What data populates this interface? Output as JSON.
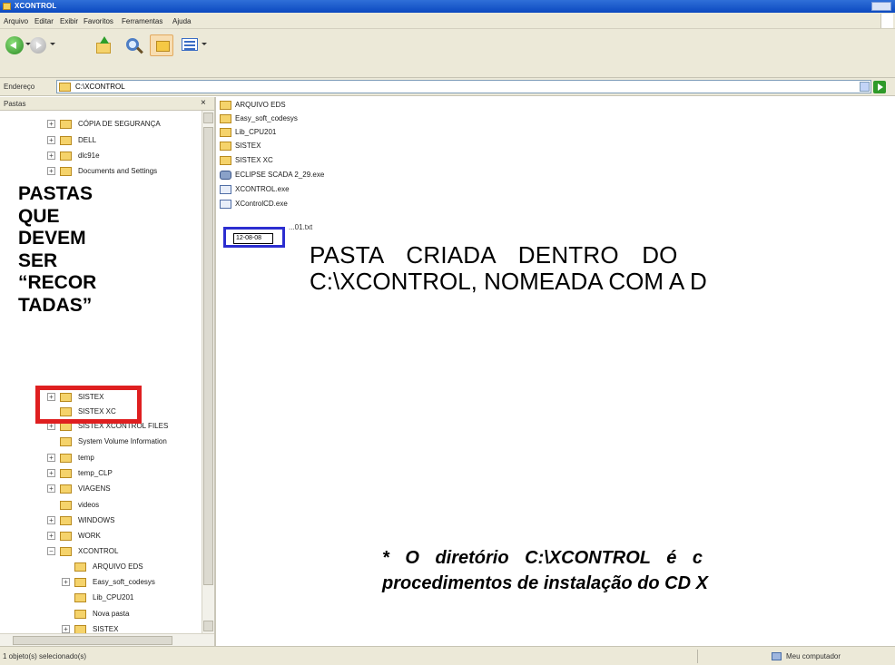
{
  "window": {
    "title": "XCONTROL"
  },
  "menu": [
    "Arquivo",
    "Editar",
    "Exibir",
    "Favoritos",
    "Ferramentas",
    "Ajuda"
  ],
  "address": {
    "label": "Endereço",
    "path": "C:\\XCONTROL"
  },
  "folders_pane": {
    "title": "Pastas",
    "close": "×",
    "tree": [
      {
        "label": "CÓPIA DE SEGURANÇA",
        "expander": "+"
      },
      {
        "label": "DELL",
        "expander": "+"
      },
      {
        "label": "dlc91e",
        "expander": "+"
      },
      {
        "label": "Documents and Settings",
        "expander": "+"
      },
      {
        "label": "SISTEX",
        "expander": "+"
      },
      {
        "label": "SISTEX XC",
        "expander": ""
      },
      {
        "label": "SISTEX XCONTROL FILES",
        "expander": "+"
      },
      {
        "label": "System Volume Information",
        "expander": ""
      },
      {
        "label": "temp",
        "expander": "+"
      },
      {
        "label": "temp_CLP",
        "expander": "+"
      },
      {
        "label": "VIAGENS",
        "expander": "+"
      },
      {
        "label": "videos",
        "expander": ""
      },
      {
        "label": "WINDOWS",
        "expander": "+"
      },
      {
        "label": "WORK",
        "expander": "+"
      },
      {
        "label": "XCONTROL",
        "expander": "−"
      },
      {
        "label": "ARQUIVO EDS",
        "expander": ""
      },
      {
        "label": "Easy_soft_codesys",
        "expander": "+"
      },
      {
        "label": "Lib_CPU201",
        "expander": ""
      },
      {
        "label": "Nova pasta",
        "expander": ""
      },
      {
        "label": "SISTEX",
        "expander": "+"
      }
    ]
  },
  "files": [
    {
      "name": "ARQUIVO EDS",
      "icon": "folder-icon"
    },
    {
      "name": "Easy_soft_codesys",
      "icon": "folder-icon"
    },
    {
      "name": "Lib_CPU201",
      "icon": "folder-icon"
    },
    {
      "name": "SISTEX",
      "icon": "folder-icon"
    },
    {
      "name": "SISTEX XC",
      "icon": "folder-icon"
    },
    {
      "name": "ECLIPSE SCADA 2_29.exe",
      "icon": "gear-icon"
    },
    {
      "name": "XCONTROL.exe",
      "icon": "exe-icon"
    },
    {
      "name": "XControlCD.exe",
      "icon": "exe-icon"
    },
    {
      "name": "...01.txt",
      "icon": "text-file-icon"
    }
  ],
  "rename": {
    "value": "12-08-08"
  },
  "annotations": {
    "left_lines": [
      "PASTAS",
      "QUE",
      "DEVEM",
      "SER",
      "“RECOR",
      "TADAS”"
    ],
    "main_line1": "PASTA CRIADA DENTRO DO",
    "main_line2": "C:\\XCONTROL, NOMEADA COM A D",
    "note_line1": "* O diretório C:\\XCONTROL é c",
    "note_line2": "procedimentos de instalação do CD X"
  },
  "status": {
    "left": "1 objeto(s) selecionado(s)",
    "right": "Meu computador"
  },
  "colors": {
    "highlight_red": "#df1f20",
    "highlight_blue": "#2c2ed0",
    "titlebar": "#0b49c0"
  }
}
